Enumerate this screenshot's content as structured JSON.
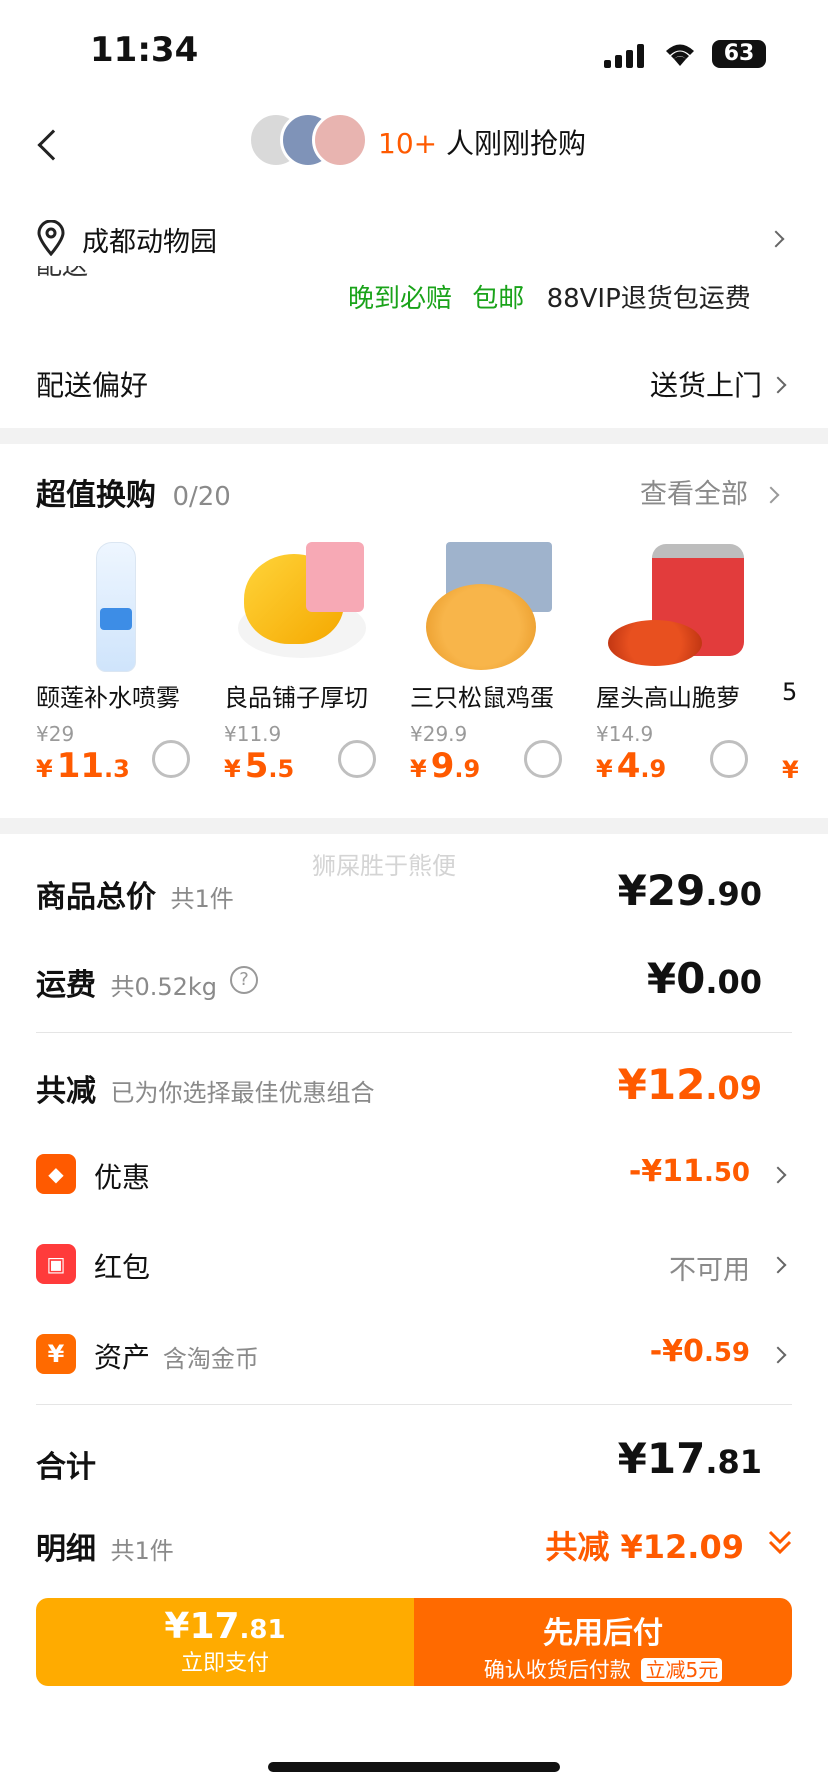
{
  "status_bar": {
    "time": "11:34",
    "battery": "63"
  },
  "header": {
    "count": "10+",
    "text": "人刚刚抢购"
  },
  "address": {
    "location": "成都动物园",
    "cut_text": "配送"
  },
  "delivery": {
    "tag_late": "晚到必赔",
    "tag_free": "包邮",
    "tag_vip": "88VIP退货包运费",
    "pref_label": "配送偏好",
    "pref_value": "送货上门"
  },
  "deals": {
    "title": "超值换购",
    "count": "0/20",
    "view_all": "查看全部",
    "items": [
      {
        "name": "颐莲补水喷雾",
        "orig": "¥29",
        "price_int": "11",
        "price_dec": ".3"
      },
      {
        "name": "良品铺子厚切",
        "orig": "¥11.9",
        "price_int": "5",
        "price_dec": ".5"
      },
      {
        "name": "三只松鼠鸡蛋",
        "orig": "¥29.9",
        "price_int": "9",
        "price_dec": ".9"
      },
      {
        "name": "屋头高山脆萝",
        "orig": "¥14.9",
        "price_int": "4",
        "price_dec": ".9"
      }
    ],
    "partial_name": "5",
    "partial_price": "¥"
  },
  "watermark": "狮屎胜于熊便",
  "summary": {
    "goods_label": "商品总价",
    "goods_count": "共1件",
    "goods_int": "¥29",
    "goods_dec": ".90",
    "freight_label": "运费",
    "freight_weight": "共0.52kg",
    "freight_int": "¥0",
    "freight_dec": ".00",
    "reduce_label": "共减",
    "reduce_note": "已为你选择最佳优惠组合",
    "reduce_int": "¥12",
    "reduce_dec": ".09",
    "discount_label": "优惠",
    "discount_int": "-¥11",
    "discount_dec": ".50",
    "redpacket_label": "红包",
    "redpacket_value": "不可用",
    "asset_label": "资产",
    "asset_note": "含淘金币",
    "asset_int": "-¥0",
    "asset_dec": ".59",
    "total_label": "合计",
    "total_int": "¥17",
    "total_dec": ".81",
    "detail_label": "明细",
    "detail_count": "共1件",
    "detail_reduce": "共减 ¥12.09"
  },
  "footer": {
    "pay_int": "¥17",
    "pay_dec": ".81",
    "pay_label": "立即支付",
    "later_title": "先用后付",
    "later_sub": "确认收货后付款",
    "later_badge": "立减5元"
  },
  "colors": {
    "accent": "#ff5a00",
    "pay_button": "#ffab00",
    "later_button": "#ff6a00",
    "green": "#1aa31a"
  }
}
